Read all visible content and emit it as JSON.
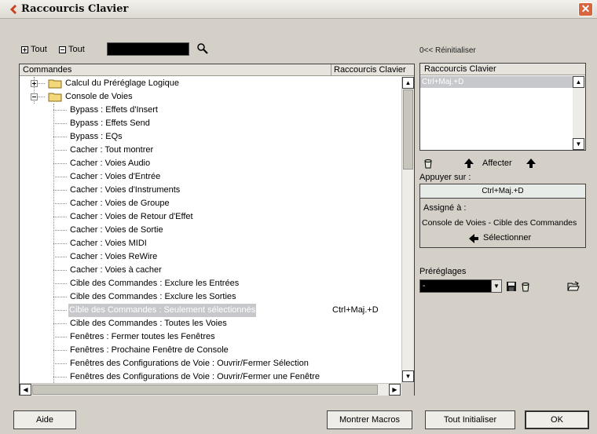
{
  "window": {
    "title": "Raccourcis Clavier",
    "accent_color": "#c8401a"
  },
  "toolbar": {
    "expand_all_label": "Tout",
    "collapse_all_label": "Tout",
    "search_value": ""
  },
  "tree": {
    "col_commands": "Commandes",
    "col_shortcuts": "Raccourcis Clavier",
    "categories": [
      {
        "label": "Calcul du Préréglage Logique",
        "expanded": false
      },
      {
        "label": "Console de Voies",
        "expanded": true
      }
    ],
    "items": [
      {
        "label": "Bypass : Effets d'Insert",
        "shortcut": ""
      },
      {
        "label": "Bypass : Effets Send",
        "shortcut": ""
      },
      {
        "label": "Bypass : EQs",
        "shortcut": ""
      },
      {
        "label": "Cacher : Tout montrer",
        "shortcut": ""
      },
      {
        "label": "Cacher : Voies Audio",
        "shortcut": ""
      },
      {
        "label": "Cacher : Voies d'Entrée",
        "shortcut": ""
      },
      {
        "label": "Cacher : Voies d'Instruments",
        "shortcut": ""
      },
      {
        "label": "Cacher : Voies de Groupe",
        "shortcut": ""
      },
      {
        "label": "Cacher : Voies de Retour d'Effet",
        "shortcut": ""
      },
      {
        "label": "Cacher : Voies de Sortie",
        "shortcut": ""
      },
      {
        "label": "Cacher : Voies MIDI",
        "shortcut": ""
      },
      {
        "label": "Cacher : Voies ReWire",
        "shortcut": ""
      },
      {
        "label": "Cacher : Voies à cacher",
        "shortcut": ""
      },
      {
        "label": "Cible des Commandes : Exclure les Entrées",
        "shortcut": ""
      },
      {
        "label": "Cible des Commandes : Exclure les Sorties",
        "shortcut": ""
      },
      {
        "label": "Cible des Commandes : Seulement sélectionnés",
        "shortcut": "Ctrl+Maj.+D",
        "selected": true
      },
      {
        "label": "Cible des Commandes : Toutes les Voies",
        "shortcut": ""
      },
      {
        "label": "Fenêtres : Fermer toutes les Fenêtres",
        "shortcut": ""
      },
      {
        "label": "Fenêtres : Prochaine Fenêtre de Console",
        "shortcut": ""
      },
      {
        "label": "Fenêtres des Configurations de Voie : Ouvrir/Fermer Sélection",
        "shortcut": ""
      },
      {
        "label": "Fenêtres des Configurations de Voie : Ouvrir/Fermer une Fenêtre",
        "shortcut": ""
      }
    ]
  },
  "right_panel": {
    "reset_label": "0<< Réinitialiser",
    "shortcuts_header": "Raccourcis Clavier",
    "shortcuts": [
      "Ctrl+Maj.+D"
    ],
    "assign_label": "Affecter",
    "press_label": "Appuyer sur :",
    "press_value": "Ctrl+Maj.+D",
    "assigned_label": "Assigné à :",
    "assigned_value": "Console de Voies - Cible des Commandes",
    "select_label": "Sélectionner",
    "presets_label": "Préréglages",
    "presets_value": "-"
  },
  "buttons": {
    "help": "Aide",
    "show_macros": "Montrer Macros",
    "reset_all": "Tout Initialiser",
    "ok": "OK"
  }
}
